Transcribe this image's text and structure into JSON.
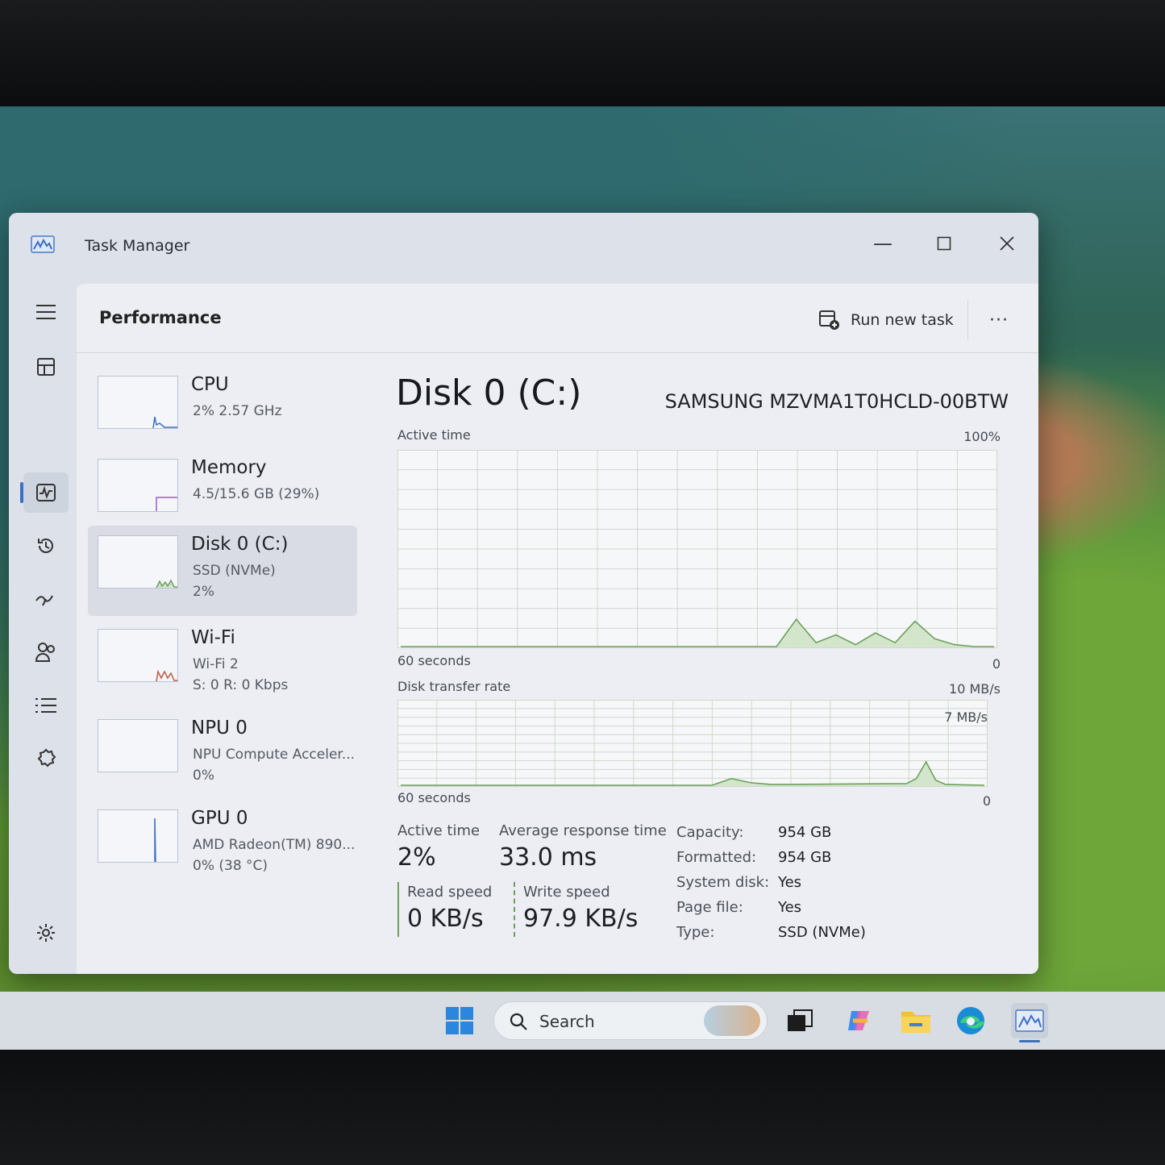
{
  "window": {
    "title": "Task Manager"
  },
  "header": {
    "title": "Performance",
    "run_new_task": "Run new task",
    "more": "···"
  },
  "devices": [
    {
      "name": "CPU",
      "sub1": "2%  2.57 GHz",
      "sub2": ""
    },
    {
      "name": "Memory",
      "sub1": "4.5/15.6 GB (29%)",
      "sub2": ""
    },
    {
      "name": "Disk 0 (C:)",
      "sub1": "SSD (NVMe)",
      "sub2": "2%"
    },
    {
      "name": "Wi-Fi",
      "sub1": "Wi-Fi 2",
      "sub2": "S: 0  R: 0 Kbps"
    },
    {
      "name": "NPU 0",
      "sub1": "NPU Compute Acceler...",
      "sub2": "0%"
    },
    {
      "name": "GPU 0",
      "sub1": "AMD Radeon(TM) 890...",
      "sub2": "0%  (38 °C)"
    }
  ],
  "detail": {
    "title": "Disk 0 (C:)",
    "model": "SAMSUNG MZVMA1T0HCLD-00BTW",
    "active_chart": {
      "label": "Active time",
      "max": "100%",
      "span": "60 seconds",
      "min": "0"
    },
    "transfer_chart": {
      "label": "Disk transfer rate",
      "max": "10 MB/s",
      "marker": "7 MB/s",
      "span": "60 seconds",
      "min": "0"
    },
    "stats": {
      "active_time_label": "Active time",
      "active_time": "2%",
      "avg_resp_label": "Average response time",
      "avg_resp": "33.0 ms",
      "read_label": "Read speed",
      "read": "0 KB/s",
      "write_label": "Write speed",
      "write": "97.9 KB/s"
    },
    "props": [
      {
        "k": "Capacity:",
        "v": "954 GB"
      },
      {
        "k": "Formatted:",
        "v": "954 GB"
      },
      {
        "k": "System disk:",
        "v": "Yes"
      },
      {
        "k": "Page file:",
        "v": "Yes"
      },
      {
        "k": "Type:",
        "v": "SSD (NVMe)"
      }
    ]
  },
  "taskbar": {
    "search_placeholder": "Search"
  },
  "chart_data": [
    {
      "type": "area",
      "title": "Active time",
      "ylim": [
        0,
        100
      ],
      "x": [
        0,
        38,
        40,
        42,
        44,
        46,
        48,
        50,
        52,
        54,
        56,
        58,
        60
      ],
      "values": [
        0,
        0,
        14,
        2,
        6,
        1,
        7,
        2,
        13,
        4,
        1,
        0,
        0
      ]
    },
    {
      "type": "area",
      "title": "Disk transfer rate",
      "ylim": [
        0,
        10
      ],
      "x": [
        0,
        32,
        34,
        36,
        38,
        40,
        52,
        53,
        54,
        55,
        56,
        60
      ],
      "values": [
        0,
        0,
        0.8,
        0.3,
        0.1,
        0.1,
        0.2,
        0.8,
        2.8,
        0.6,
        0.1,
        0
      ]
    }
  ],
  "colors": {
    "accent": "#3d6fc2",
    "disk_line": "#6ca05c",
    "disk_fill": "#cfe3c7",
    "grid": "#cfd8cc"
  }
}
